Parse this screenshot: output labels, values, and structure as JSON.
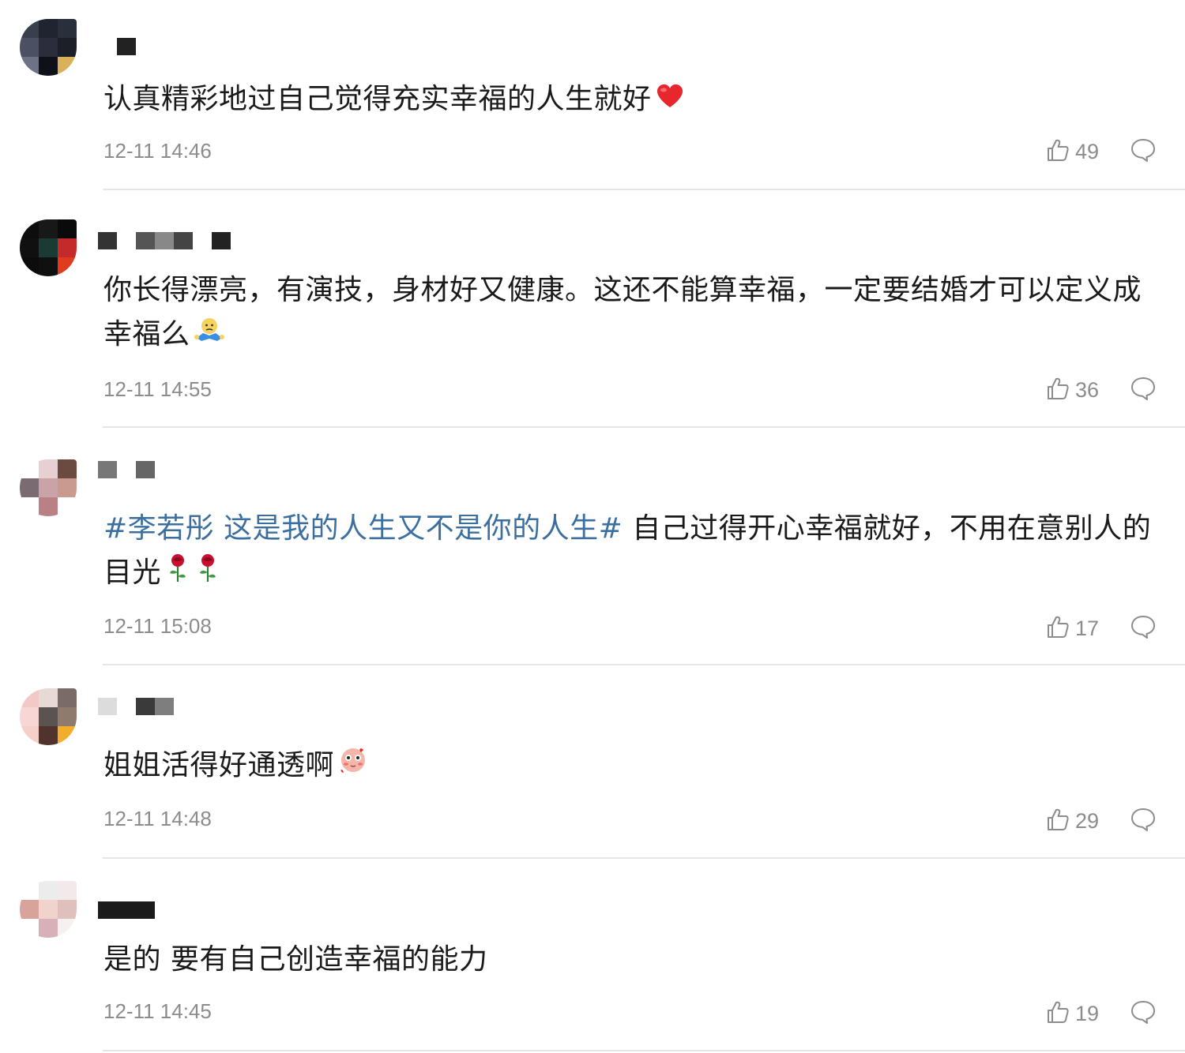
{
  "comments": [
    {
      "text_plain": "认真精彩地过自己觉得充实幸福的人生就好",
      "emoji": "heart",
      "time": "12-11 14:46",
      "likes": "49",
      "avatar_colors": [
        "#3a3f4d",
        "#1f2430",
        "#2a2f3c",
        "#4b5062",
        "#2b2d3b",
        "#1c1f28",
        "#6e7286",
        "#0e1117",
        "#d9b15a"
      ],
      "name_blocks": [
        "#ffffff",
        "#222222",
        "#ffffff"
      ]
    },
    {
      "text_plain": "你长得漂亮，有演技，身材好又健康。这还不能算幸福，一定要结婚才可以定义成幸福么",
      "emoji": "shrug",
      "time": "12-11 14:55",
      "likes": "36",
      "avatar_colors": [
        "#0d0d0d",
        "#181818",
        "#0a0a0a",
        "#101010",
        "#1a3a33",
        "#c42a2a",
        "#0c0c0c",
        "#101010",
        "#e03a1f"
      ],
      "name_blocks": [
        "#333333",
        "#ffffff",
        "#555555",
        "#888888",
        "#444444",
        "#ffffff",
        "#222222"
      ]
    },
    {
      "hashtag": "#李若彤 这是我的人生又不是你的人生#",
      "text_plain": " 自己过得开心幸福就好，不用在意别人的目光",
      "emoji": "roses",
      "time": "12-11 15:08",
      "likes": "17",
      "avatar_colors": [
        "#ffffff",
        "#e8d0d2",
        "#6b4a40",
        "#7a6a72",
        "#caa3a8",
        "#c99a8f",
        "#ffffff",
        "#b98185",
        "#ffffff"
      ],
      "name_blocks": [
        "#777777",
        "#ffffff",
        "#666666"
      ]
    },
    {
      "text_plain": "姐姐活得好通透啊",
      "emoji": "shy",
      "time": "12-11 14:48",
      "likes": "29",
      "avatar_colors": [
        "#f2c9c7",
        "#e7d9d6",
        "#7a6b66",
        "#f7d6d4",
        "#5a534f",
        "#8f7b6e",
        "#f5cfc9",
        "#50332c",
        "#f3ad2d"
      ],
      "name_blocks": [
        "#dcdcdc",
        "#ffffff",
        "#3a3a3a",
        "#7e7e7e"
      ]
    },
    {
      "text_plain": "是的 要有自己创造幸福的能力",
      "emoji": "",
      "time": "12-11 14:45",
      "likes": "19",
      "avatar_colors": [
        "#ffffff",
        "#ececec",
        "#f2eaea",
        "#d9a29a",
        "#f1d3ce",
        "#e0c0bd",
        "#ffffff",
        "#d7b1b7",
        "#f6f1f0"
      ],
      "name_blocks": [
        "#1a1a1a"
      ]
    }
  ],
  "colors": {
    "text": "#1a1a1a",
    "meta": "#8c8c8c",
    "hashtag": "#3b6fa0",
    "divider": "#e6e6e6"
  },
  "icons": [
    "thumbs-up-icon",
    "comment-bubble-icon",
    "heart-emoji",
    "shrug-emoji",
    "rose-emoji",
    "shy-emoji"
  ]
}
